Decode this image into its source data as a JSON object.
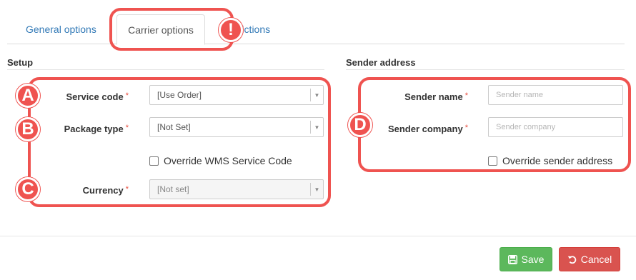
{
  "tabs": [
    {
      "label": "General options"
    },
    {
      "label": "Carrier options"
    },
    {
      "label": "Restrictions"
    }
  ],
  "setup": {
    "title": "Setup",
    "service_code": {
      "label": "Service code",
      "value": "[Use Order]"
    },
    "package_type": {
      "label": "Package type",
      "value": "[Not Set]"
    },
    "override_wms": {
      "label": "Override WMS Service Code",
      "checked": false
    },
    "currency": {
      "label": "Currency",
      "value": "[Not set]"
    }
  },
  "sender": {
    "title": "Sender address",
    "name": {
      "label": "Sender name",
      "placeholder": "Sender name",
      "value": ""
    },
    "company": {
      "label": "Sender company",
      "placeholder": "Sender company",
      "value": ""
    },
    "override": {
      "label": "Override sender address",
      "checked": false
    }
  },
  "required_mark": "*",
  "annotations": {
    "a": "A",
    "b": "B",
    "c": "C",
    "d": "D",
    "alert": "!"
  },
  "buttons": {
    "save": "Save",
    "cancel": "Cancel"
  },
  "colors": {
    "annotation": "#ef5350",
    "save": "#5cb85c",
    "cancel": "#d9534f",
    "link": "#337ab7"
  }
}
